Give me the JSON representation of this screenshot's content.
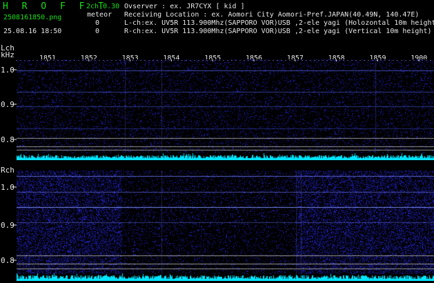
{
  "header": {
    "app_name": "H R O F F T",
    "channel_mode": "2ch 0.30",
    "detector": "meteor",
    "filename": "2508161850.png",
    "count_l": "0",
    "timestamp": "25.08.16 18:50",
    "count_r": "0",
    "observer": "Ovserver          : ex. JR7CYX [ kid ]",
    "location": "Receiving Location : ex. Aomori City Aomori-Pref.JAPAN(40.49N, 140.47E)",
    "lch_info": "L-ch:ex. UV5R 113.900Mhz(SAPPORO VOR)USB ,2-ele yagi (Holozontal 10m height)",
    "rch_info": "R-ch:ex. UV5R 113.900Mhz(SAPPORO VOR)USB ,2-ele yagi (Vertical 10m height)"
  },
  "time_axis": {
    "labels": [
      "1851",
      "1852",
      "1853",
      "1854",
      "1855",
      "1856",
      "1857",
      "1858",
      "1859",
      "1900"
    ]
  },
  "lch": {
    "title": "Lch",
    "unit": "kHz",
    "yticks": [
      "1.0",
      "0.9",
      "0.8"
    ]
  },
  "rch": {
    "title": "Rch",
    "yticks": [
      "1.0",
      "0.9",
      "0.8"
    ]
  },
  "colors": {
    "background": "#000000",
    "noise": "#2a2ad0",
    "signal_line": "#6f7cff",
    "level_trace": "#00e5ff",
    "header_green": "#19e019",
    "text_white": "#e8e8e8"
  }
}
